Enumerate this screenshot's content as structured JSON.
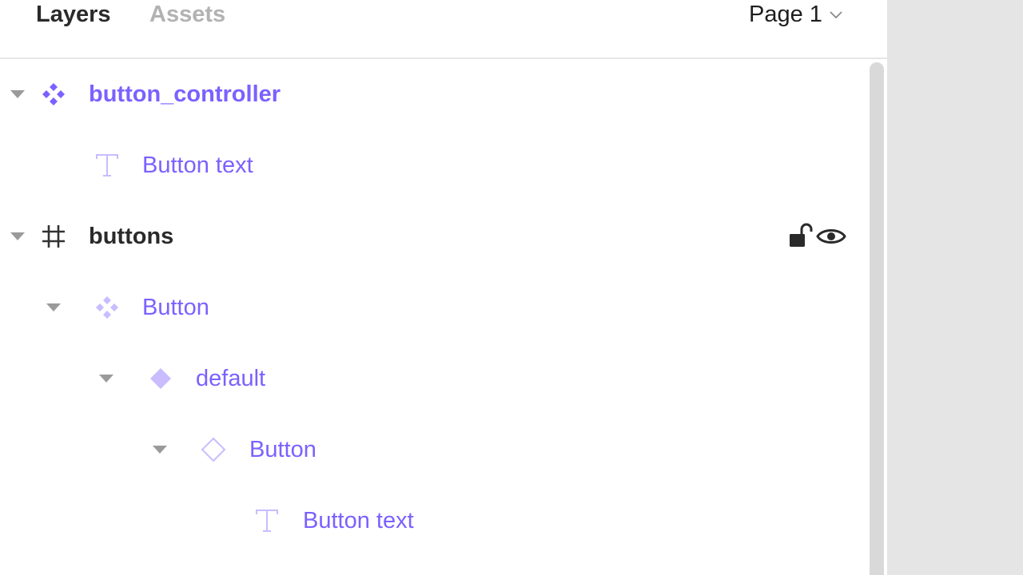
{
  "tabs": {
    "layers": "Layers",
    "assets": "Assets"
  },
  "page_selector": {
    "label": "Page 1"
  },
  "layers": [
    {
      "name": "button_controller"
    },
    {
      "name": "Button text"
    },
    {
      "name": "buttons"
    },
    {
      "name": "Button"
    },
    {
      "name": "default"
    },
    {
      "name": "Button"
    },
    {
      "name": "Button text"
    }
  ],
  "colors": {
    "accent": "#7b61ff",
    "accent_light": "#c9bcff",
    "text_dark": "#2a2a2a",
    "tab_inactive": "#b2b2b2"
  },
  "icons": {
    "component_set": "component-set-icon",
    "text_layer": "text-layer-icon",
    "frame": "frame-hash-icon",
    "variant": "variant-diamond-icon",
    "instance": "instance-diamond-outline-icon",
    "lock": "unlock-icon",
    "visibility": "eye-icon"
  }
}
